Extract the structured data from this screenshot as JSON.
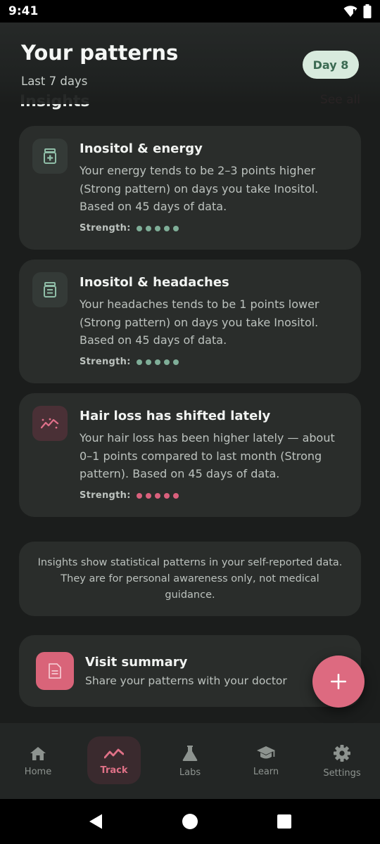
{
  "status_bar": {
    "time": "9:41"
  },
  "header": {
    "title": "Your patterns",
    "subtitle": "Last 7 days",
    "day_badge": "Day 8"
  },
  "section": {
    "title": "Insights",
    "see_all": "See all"
  },
  "insights": [
    {
      "icon": "medication-icon",
      "title": "Inositol & energy",
      "body": "Your energy tends to be 2–3 points higher (Strong pattern) on days you take Inositol. Based on 45 days of data.",
      "strength_label": "Strength:",
      "strength": 5,
      "color": "#7fae98"
    },
    {
      "icon": "medication-icon",
      "title": "Inositol & headaches",
      "body": "Your headaches tends to be 1 points lower (Strong pattern) on days you take Inositol. Based on 45 days of data.",
      "strength_label": "Strength:",
      "strength": 5,
      "color": "#7fae98"
    },
    {
      "icon": "trend-icon",
      "title": "Hair loss has shifted lately",
      "body": "Your hair loss has been higher lately — about 0–1 points compared to last month (Strong pattern). Based on 45 days of data.",
      "strength_label": "Strength:",
      "strength": 5,
      "color": "#d9607c"
    }
  ],
  "disclaimer": "Insights show statistical patterns in your self-reported data. They are for personal awareness only, not medical guidance.",
  "visit_summary": {
    "title": "Visit summary",
    "subtitle": "Share your patterns with your doctor"
  },
  "fab": {
    "icon": "plus-icon"
  },
  "bottom_nav": [
    {
      "label": "Home",
      "icon": "home-icon",
      "active": false
    },
    {
      "label": "Track",
      "icon": "trend-icon",
      "active": true
    },
    {
      "label": "Labs",
      "icon": "flask-icon",
      "active": false
    },
    {
      "label": "Learn",
      "icon": "graduation-cap-icon",
      "active": false
    },
    {
      "label": "Settings",
      "icon": "gear-icon",
      "active": false
    }
  ],
  "colors": {
    "accent": "#d9607c",
    "positive": "#7fae98",
    "badge_bg": "#d8eadd",
    "badge_text": "#3b6a52"
  }
}
